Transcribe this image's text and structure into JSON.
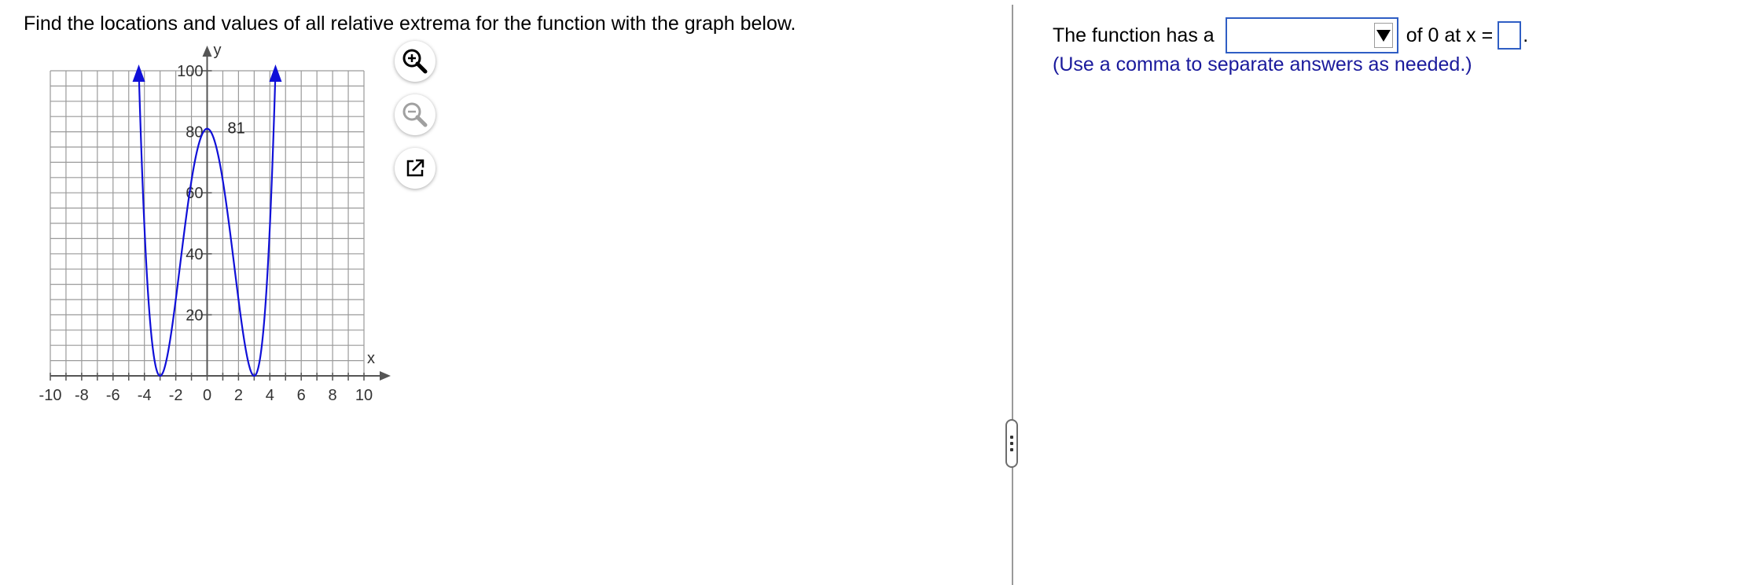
{
  "question": {
    "text": "Find the locations and values of all relative extrema for the function with the graph below."
  },
  "graph": {
    "x_axis_label": "x",
    "y_axis_label": "y",
    "x_tick_labels": [
      "-10",
      "-8",
      "-6",
      "-4",
      "-2",
      "0",
      "2",
      "4",
      "6",
      "8",
      "10"
    ],
    "y_tick_labels": [
      "20",
      "40",
      "60",
      "80",
      "100"
    ],
    "annotation": "81",
    "curve_color": "#1010d8",
    "tools": {
      "zoom_in": "zoom-in-icon",
      "zoom_out": "zoom-out-icon",
      "popout": "popout-icon"
    }
  },
  "chart_data": {
    "type": "line",
    "title": "",
    "xlabel": "x",
    "ylabel": "y",
    "xlim": [
      -10,
      10
    ],
    "ylim": [
      0,
      100
    ],
    "x_ticks": [
      -10,
      -8,
      -6,
      -4,
      -2,
      0,
      2,
      4,
      6,
      8,
      10
    ],
    "y_ticks": [
      20,
      40,
      60,
      80,
      100
    ],
    "grid": true,
    "series": [
      {
        "color": "#1010d8",
        "function": "(x^2 - 9)^2",
        "x_domain": [
          -4.24,
          4.24
        ],
        "arrows_at_ends": true,
        "key_points": [
          [
            -3,
            0
          ],
          [
            0,
            81
          ],
          [
            3,
            0
          ]
        ]
      }
    ],
    "annotations": [
      {
        "x": 0,
        "y": 81,
        "text": "81"
      }
    ]
  },
  "answer": {
    "prefix": "The function has a",
    "dropdown_value": "",
    "middle": "of 0 at x =",
    "input_value": "",
    "suffix": ".",
    "hint": "(Use a comma to separate answers as needed.)"
  }
}
